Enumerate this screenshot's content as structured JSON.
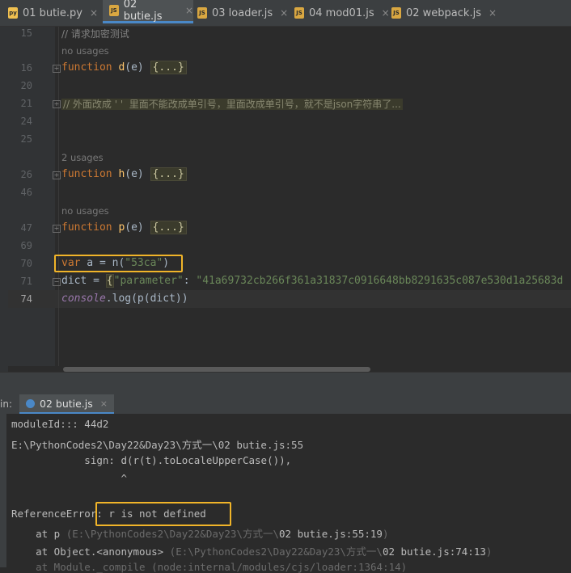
{
  "tabs": [
    {
      "name": "01 butie.py",
      "badge": "py"
    },
    {
      "name": "02 butie.js",
      "badge": "JS",
      "active": true
    },
    {
      "name": "03 loader.js",
      "badge": "JS"
    },
    {
      "name": "04 mod01.js",
      "badge": "JS"
    },
    {
      "name": "02 webpack.js",
      "badge": "JS"
    }
  ],
  "tab_close": "×",
  "editor": {
    "line_numbers": [
      "15",
      "16",
      "20",
      "21",
      "24",
      "25",
      "26",
      "46",
      "47",
      "69",
      "70",
      "71",
      "74"
    ],
    "hints": {
      "no_usages_1": "no usages",
      "two_usages": "2 usages",
      "no_usages_2": "no usages"
    },
    "comment15": "// 请求加密测试",
    "comment21": "// 外面改成 ' '  里面不能改成单引号，里面改成单引号，就不是json字符串了...",
    "kw_function": "function",
    "kw_var": "var",
    "d_name": "d",
    "h_name": "h",
    "p_name": "p",
    "param": "(e) ",
    "collapsed": "{...}",
    "line70_a": " a = ",
    "line70_n": "n",
    "line70_open": "(",
    "line70_str": "\"53ca\"",
    "line70_close": ")",
    "line71_pre": "dict = ",
    "line71_brace": "{",
    "line71_key": "\"parameter\"",
    "line71_colon": ": ",
    "line71_val": "\"41a69732cb266f361a31837c0916648bb8291635c087e530d1a25683d",
    "line74_console": "console",
    "line74_rest": ".log(p(dict))",
    "fold_minus": "−",
    "fold_plus": "+"
  },
  "run": {
    "label": "in:",
    "tab": "02 butie.js",
    "lines": [
      "moduleId::: 44d2",
      "E:\\PythonCodes2\\Day22&Day23\\方式一\\02 butie.js:55",
      "            sign: d(r(t).toLocaleUpperCase()),",
      "                  ^",
      "",
      "ReferenceError: r is not defined"
    ],
    "at1_pre": "    at p ",
    "at1_loc": "(E:\\PythonCodes2\\Day22&Day23\\方式一\\",
    "at1_file": "02 butie.js:55:19",
    "at1_end": ")",
    "at2_pre": "    at Object.<anonymous> ",
    "at2_loc": "(E:\\PythonCodes2\\Day22&Day23\\方式一\\",
    "at2_file": "02 butie.js:74:13",
    "at2_end": ")",
    "at3": "    at Module._compile (node:internal/modules/cjs/loader:1364:14)"
  },
  "colors": {
    "highlight_box": "#f0b429",
    "keyword": "#cc7832",
    "function_name": "#ffc66d",
    "string": "#6a8759"
  }
}
